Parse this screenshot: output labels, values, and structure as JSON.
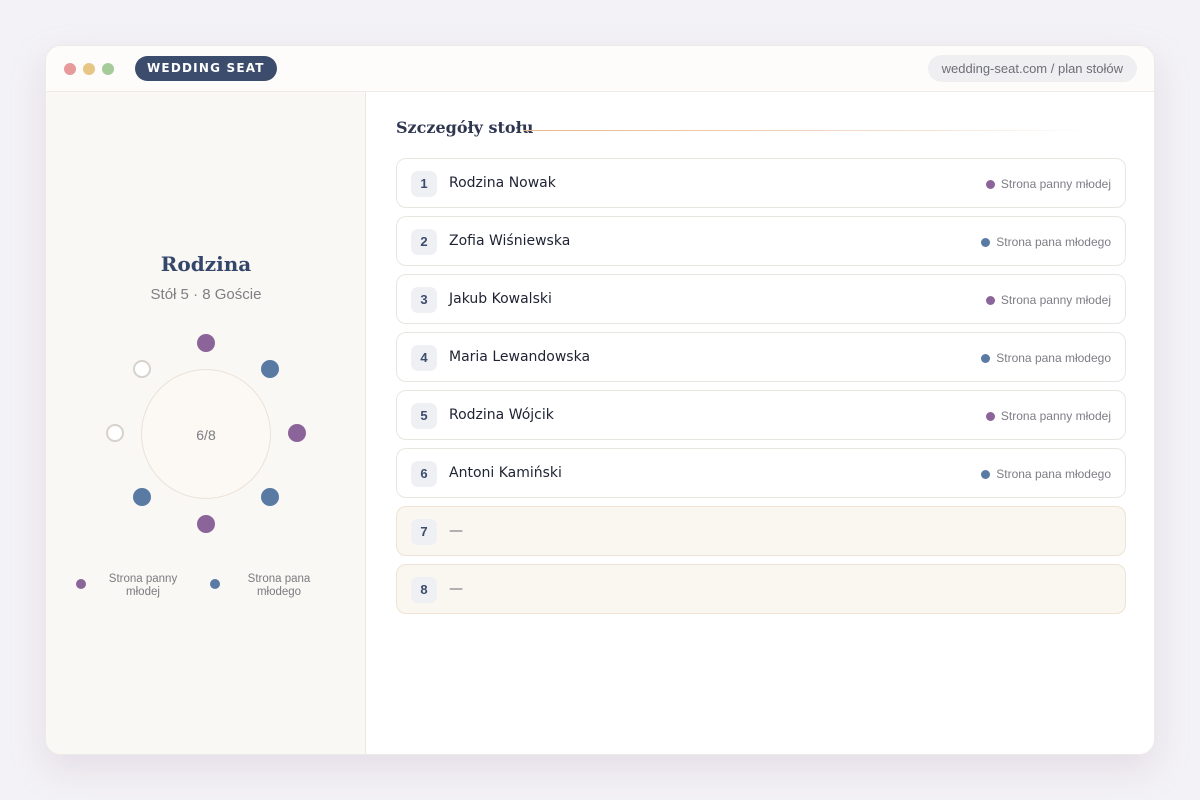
{
  "window": {
    "brand": "WEDDING SEAT",
    "url": "wedding-seat.com / plan stołów"
  },
  "table": {
    "name": "Rodzina",
    "subtitle": "Stół 5 · 8 Goście",
    "occupancy": "6/8",
    "seats": [
      "bride",
      "groom",
      "bride",
      "groom",
      "bride",
      "groom",
      "empty",
      "empty"
    ]
  },
  "legend": {
    "bride_label": "Strona panny młodej",
    "groom_label": "Strona pana młodego"
  },
  "details": {
    "title": "Szczegóły stołu",
    "guests": [
      {
        "num": "1",
        "name": "Rodzina Nowak",
        "side": "Strona panny młodej",
        "side_type": "bride"
      },
      {
        "num": "2",
        "name": "Zofia Wiśniewska",
        "side": "Strona pana młodego",
        "side_type": "groom"
      },
      {
        "num": "3",
        "name": "Jakub Kowalski",
        "side": "Strona panny młodej",
        "side_type": "bride"
      },
      {
        "num": "4",
        "name": "Maria Lewandowska",
        "side": "Strona pana młodego",
        "side_type": "groom"
      },
      {
        "num": "5",
        "name": "Rodzina Wójcik",
        "side": "Strona panny młodej",
        "side_type": "bride"
      },
      {
        "num": "6",
        "name": "Antoni Kamiński",
        "side": "Strona pana młodego",
        "side_type": "groom"
      },
      {
        "num": "7",
        "name": "—",
        "side": "",
        "side_type": "empty"
      },
      {
        "num": "8",
        "name": "—",
        "side": "",
        "side_type": "empty"
      }
    ]
  },
  "colors": {
    "bride": "#8b659a",
    "groom": "#587aa3",
    "brand": "#3b4c6d"
  }
}
